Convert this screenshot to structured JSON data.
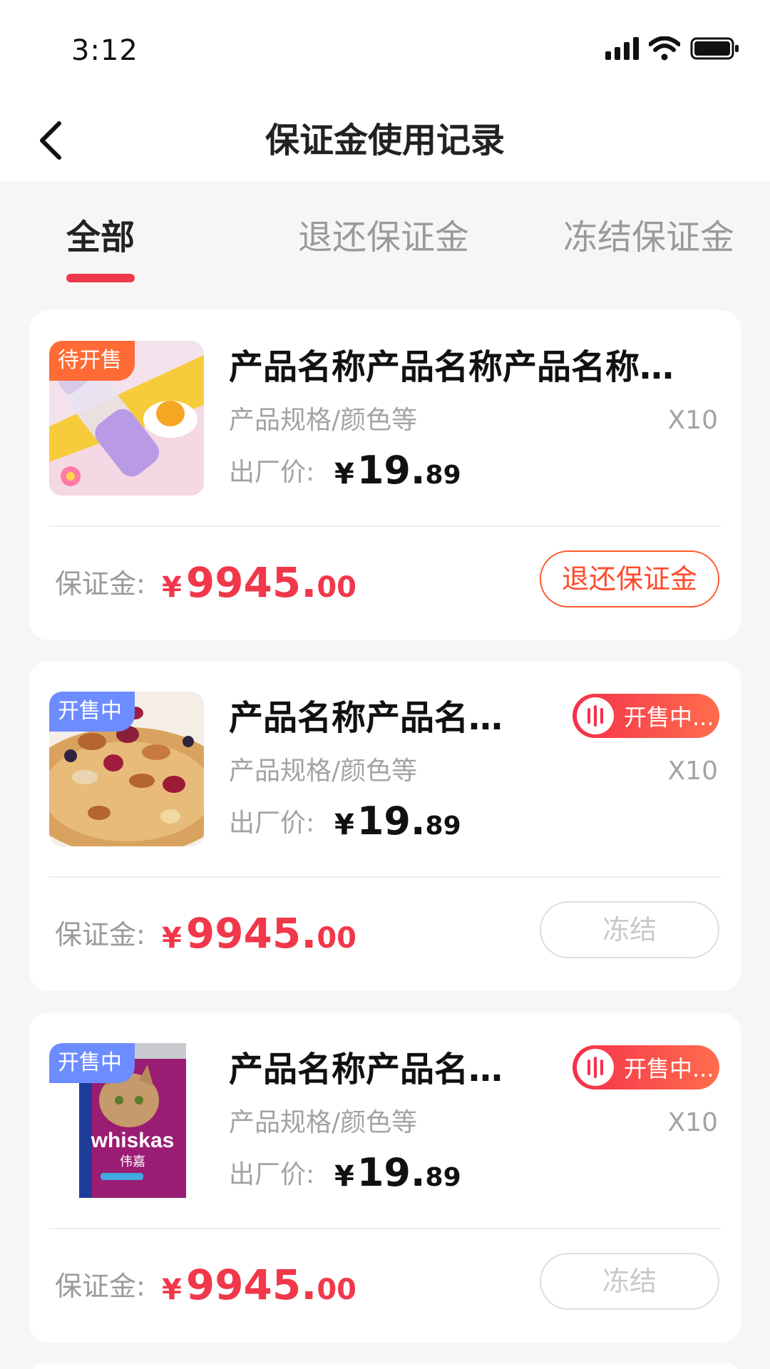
{
  "status_bar": {
    "time": "3:12"
  },
  "nav": {
    "title": "保证金使用记录"
  },
  "tabs": [
    {
      "label": "全部",
      "active": true
    },
    {
      "label": "退还保证金",
      "active": false
    },
    {
      "label": "冻结保证金",
      "active": false
    }
  ],
  "colors": {
    "accent": "#f0384a",
    "orange": "#ff6a35",
    "blue_tag": "#6d8cff"
  },
  "records": [
    {
      "thumb_tag": "待开售",
      "thumb_icon": "water-bottle-product-image",
      "name": "产品名称产品名称产品名称…",
      "spec": "产品规格/颜色等",
      "qty": "X10",
      "price_label": "出厂价:",
      "price_currency": "¥",
      "price_int": "19.",
      "price_dec": "89",
      "deposit_label": "保证金:",
      "deposit_currency": "¥",
      "deposit_int": "9945.",
      "deposit_dec": "00",
      "action": "退还保证金"
    },
    {
      "thumb_tag": "开售中",
      "thumb_icon": "mixed-nuts-product-image",
      "name": "产品名称产品名…",
      "badge": "开售中...",
      "spec": "产品规格/颜色等",
      "qty": "X10",
      "price_label": "出厂价:",
      "price_currency": "¥",
      "price_int": "19.",
      "price_dec": "89",
      "deposit_label": "保证金:",
      "deposit_currency": "¥",
      "deposit_int": "9945.",
      "deposit_dec": "00",
      "action": "冻结"
    },
    {
      "thumb_tag": "开售中",
      "thumb_icon": "cat-food-can-product-image",
      "thumb_brand": "whiskas",
      "thumb_brand_cn": "伟嘉",
      "name": "产品名称产品名…",
      "badge": "开售中...",
      "spec": "产品规格/颜色等",
      "qty": "X10",
      "price_label": "出厂价:",
      "price_currency": "¥",
      "price_int": "19.",
      "price_dec": "89",
      "deposit_label": "保证金:",
      "deposit_currency": "¥",
      "deposit_int": "9945.",
      "deposit_dec": "00",
      "action": "冻结"
    }
  ]
}
